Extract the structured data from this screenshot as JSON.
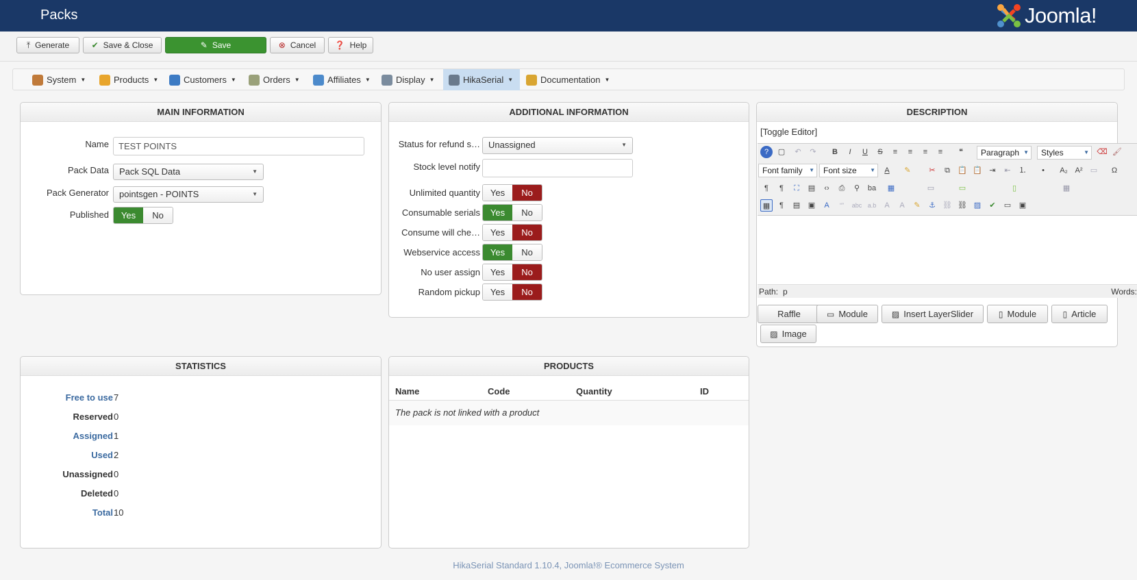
{
  "header": {
    "title": "Packs",
    "logo_text": "Joomla!"
  },
  "toolbar": {
    "generate": "Generate",
    "save_close": "Save & Close",
    "save": "Save",
    "cancel": "Cancel",
    "help": "Help"
  },
  "menu": [
    {
      "label": "System",
      "icon": "tools-icon"
    },
    {
      "label": "Products",
      "icon": "products-icon"
    },
    {
      "label": "Customers",
      "icon": "customers-icon"
    },
    {
      "label": "Orders",
      "icon": "orders-icon"
    },
    {
      "label": "Affiliates",
      "icon": "affiliates-icon"
    },
    {
      "label": "Display",
      "icon": "display-icon"
    },
    {
      "label": "HikaSerial",
      "icon": "hikaserial-icon",
      "active": true
    },
    {
      "label": "Documentation",
      "icon": "documentation-icon"
    }
  ],
  "main_info": {
    "title": "MAIN INFORMATION",
    "name_label": "Name",
    "name_value": "TEST POINTS",
    "pack_data_label": "Pack Data",
    "pack_data_value": "Pack SQL Data",
    "pack_generator_label": "Pack Generator",
    "pack_generator_value": "pointsgen - POINTS",
    "published_label": "Published",
    "published": "Yes"
  },
  "additional_info": {
    "title": "ADDITIONAL INFORMATION",
    "status_refund_label": "Status for refund s…",
    "status_refund_value": "Unassigned",
    "stock_notify_label": "Stock level notify",
    "stock_notify_value": "",
    "toggles": [
      {
        "label": "Unlimited quantity",
        "value": "No"
      },
      {
        "label": "Consumable serials",
        "value": "Yes"
      },
      {
        "label": "Consume will che…",
        "value": "No"
      },
      {
        "label": "Webservice access",
        "value": "Yes"
      },
      {
        "label": "No user assign",
        "value": "No"
      },
      {
        "label": "Random pickup",
        "value": "No"
      }
    ],
    "yes": "Yes",
    "no": "No"
  },
  "description": {
    "title": "DESCRIPTION",
    "toggle_editor": "[Toggle Editor]",
    "format_select": "Paragraph",
    "styles_select": "Styles",
    "font_family": "Font family",
    "font_size": "Font size",
    "path_label": "Path:",
    "path_value": "p",
    "words_label": "Words:",
    "buttons": [
      "Raffle",
      "Module",
      "Insert LayerSlider",
      "Module",
      "Article",
      "Image"
    ]
  },
  "statistics": {
    "title": "STATISTICS",
    "rows": [
      {
        "label": "Free to use",
        "value": "7",
        "link": true
      },
      {
        "label": "Reserved",
        "value": "0",
        "link": false
      },
      {
        "label": "Assigned",
        "value": "1",
        "link": true
      },
      {
        "label": "Used",
        "value": "2",
        "link": true
      },
      {
        "label": "Unassigned",
        "value": "0",
        "link": false
      },
      {
        "label": "Deleted",
        "value": "0",
        "link": false
      },
      {
        "label": "Total",
        "value": "10",
        "link": true
      }
    ]
  },
  "products": {
    "title": "PRODUCTS",
    "columns": [
      "Name",
      "Code",
      "Quantity",
      "ID"
    ],
    "empty_message": "The pack is not linked with a product"
  },
  "footer": {
    "text": "HikaSerial Standard 1.10.4, Joomla!® Ecommerce System"
  },
  "colors": {
    "header": "#1a3867",
    "save_green": "#3b9330",
    "yes_green": "#3b8a30",
    "no_red": "#9b1c1c",
    "link_blue": "#3b6aa0"
  }
}
